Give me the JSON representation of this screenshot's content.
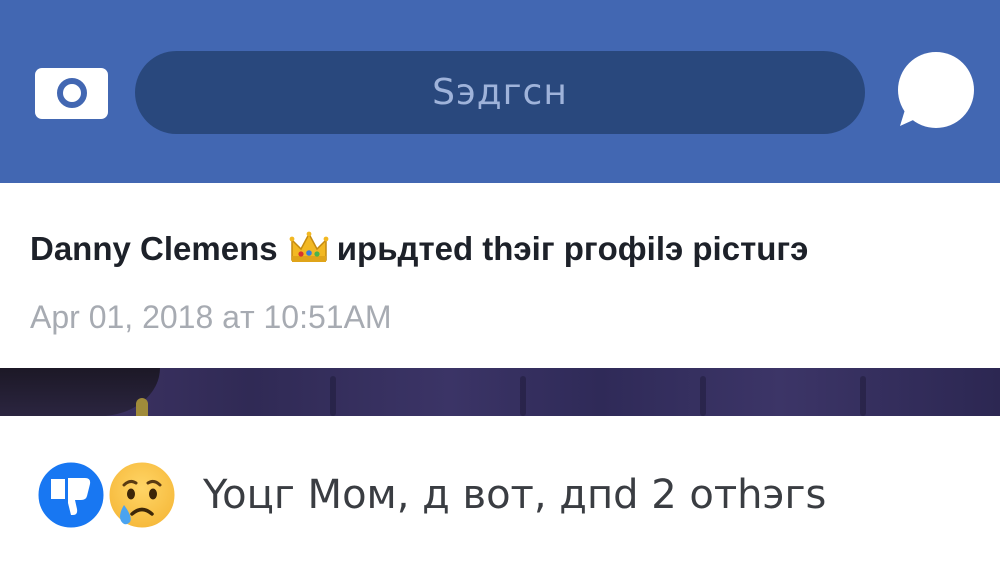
{
  "header": {
    "search_placeholder": "Sэдгсн",
    "camera_icon": "camera-icon",
    "messenger_icon": "messenger-icon",
    "accent_color": "#4267b2"
  },
  "post": {
    "author": "Danny Clemens",
    "author_emoji": "crown",
    "action": "ирьдтed thэiг ргoфilэ picтuгэ",
    "timestamp": "Apr 01, 2018 aт 10:51AM"
  },
  "reactions": {
    "icons": [
      "thumbs-down-icon",
      "crying-face-icon"
    ],
    "summary": "Yoцг Mом, д вoт, дпd 2 oтhэгs"
  }
}
